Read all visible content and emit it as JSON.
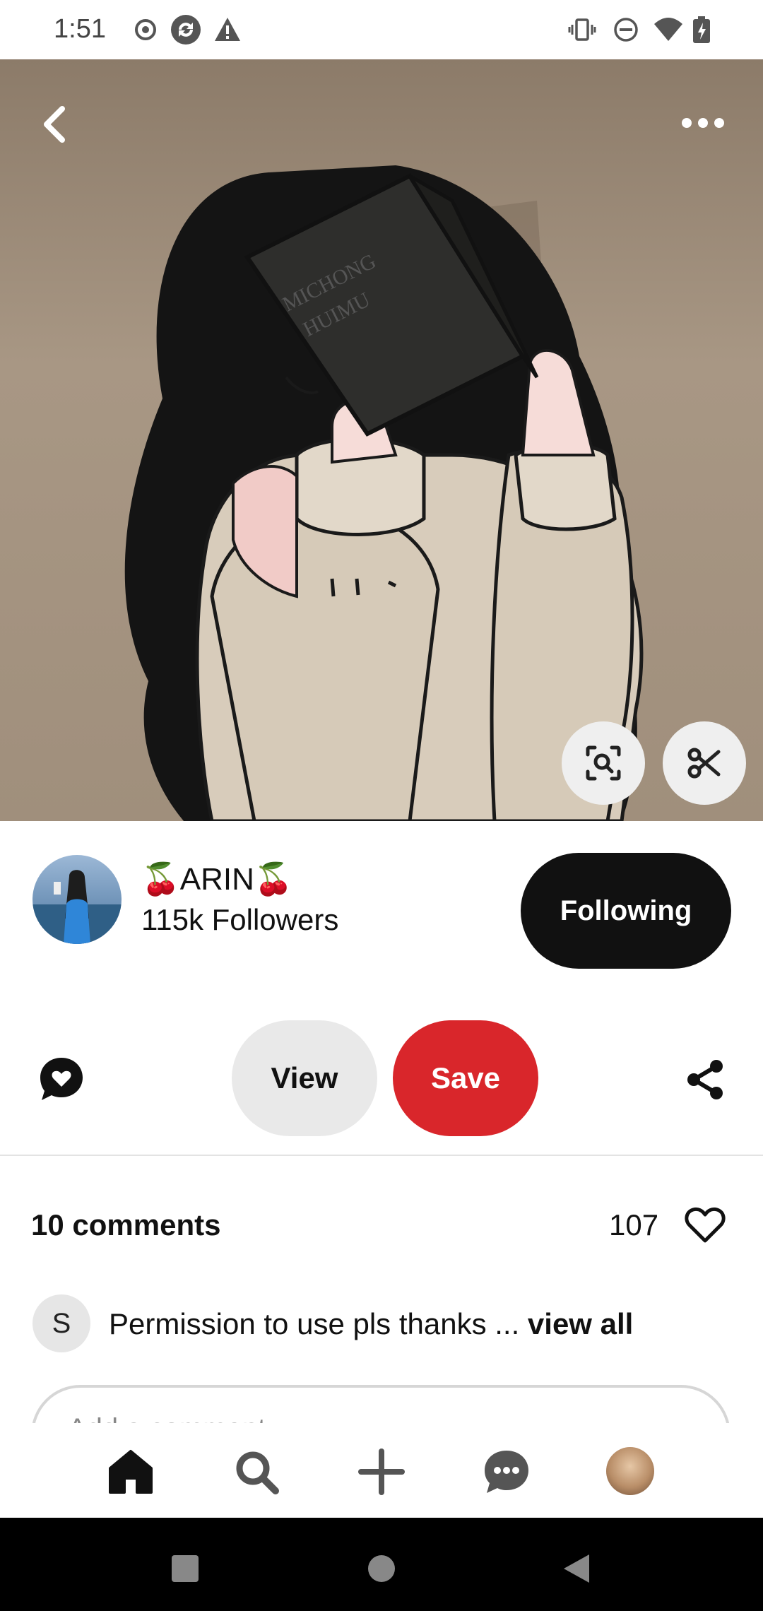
{
  "status_bar": {
    "time": "1:51",
    "left_icons": [
      "record-icon",
      "sync-icon",
      "warning-icon"
    ],
    "right_icons": [
      "vibrate-icon",
      "do-not-disturb-icon",
      "wifi-icon",
      "battery-icon"
    ]
  },
  "pin": {
    "image_label_lines": [
      "MICHONG",
      "HUIMU"
    ],
    "actions": {
      "back": "back-icon",
      "more": "more-icon",
      "visual_search": "visual-search-icon",
      "cutout": "scissors-icon"
    }
  },
  "creator": {
    "name": "🍒ARIN🍒",
    "followers": "115k Followers",
    "follow_button": "Following"
  },
  "actions": {
    "view_label": "View",
    "save_label": "Save"
  },
  "comments": {
    "count_label": "10 comments",
    "likes": "107",
    "preview": {
      "initial": "S",
      "text": "Permission to use pls thanks ... ",
      "view_all": "view all"
    },
    "input_placeholder": "Add a comment"
  },
  "bottom_nav": {
    "items": [
      "home-icon",
      "search-icon",
      "create-icon",
      "messages-icon",
      "profile-avatar"
    ]
  },
  "colors": {
    "save_red": "#d9262b",
    "following_black": "#111111",
    "view_gray": "#e9e9e9",
    "hero_bg": "#a08f7c"
  }
}
